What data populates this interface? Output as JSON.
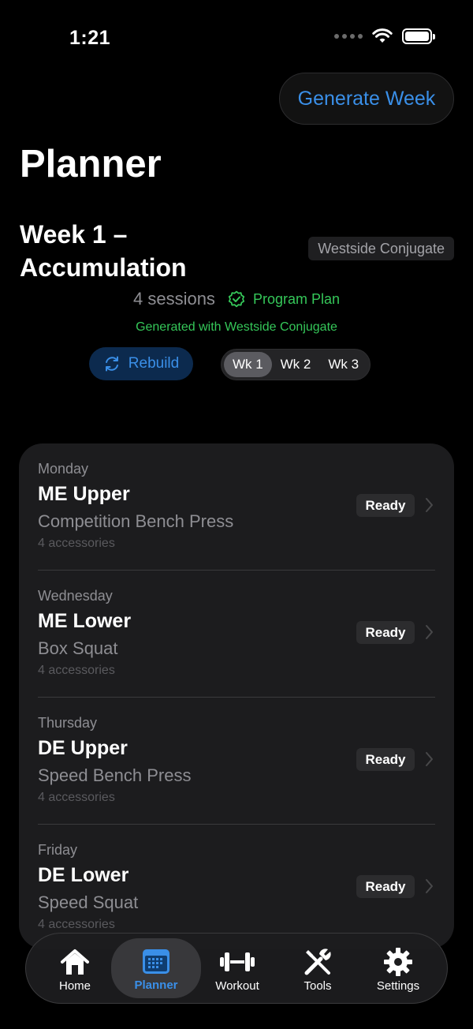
{
  "status": {
    "time": "1:21"
  },
  "header": {
    "generate_label": "Generate Week",
    "title": "Planner"
  },
  "week": {
    "title": "Week 1 – Accumulation",
    "program": "Westside Conjugate",
    "sessions": "4 sessions",
    "plan_label": "Program Plan",
    "generated_text": "Generated with Westside Conjugate",
    "rebuild_label": "Rebuild",
    "tabs": [
      "Wk 1",
      "Wk 2",
      "Wk 3"
    ],
    "active_tab": "Wk 1"
  },
  "sessions": [
    {
      "day": "Monday",
      "title": "ME Upper",
      "main_lift": "Competition Bench Press",
      "accessories": "4 accessories",
      "status": "Ready"
    },
    {
      "day": "Wednesday",
      "title": "ME Lower",
      "main_lift": "Box Squat",
      "accessories": "4 accessories",
      "status": "Ready"
    },
    {
      "day": "Thursday",
      "title": "DE Upper",
      "main_lift": "Speed Bench Press",
      "accessories": "4 accessories",
      "status": "Ready"
    },
    {
      "day": "Friday",
      "title": "DE Lower",
      "main_lift": "Speed Squat",
      "accessories": "4 accessories",
      "status": "Ready"
    }
  ],
  "tabbar": {
    "items": [
      {
        "label": "Home",
        "icon": "house-icon"
      },
      {
        "label": "Planner",
        "icon": "calendar-icon",
        "active": true
      },
      {
        "label": "Workout",
        "icon": "dumbbell-icon"
      },
      {
        "label": "Tools",
        "icon": "tools-icon"
      },
      {
        "label": "Settings",
        "icon": "gear-icon"
      }
    ]
  },
  "colors": {
    "accent": "#3a8fe8",
    "success": "#35c759",
    "background": "#000000",
    "card": "#1c1c1e"
  }
}
